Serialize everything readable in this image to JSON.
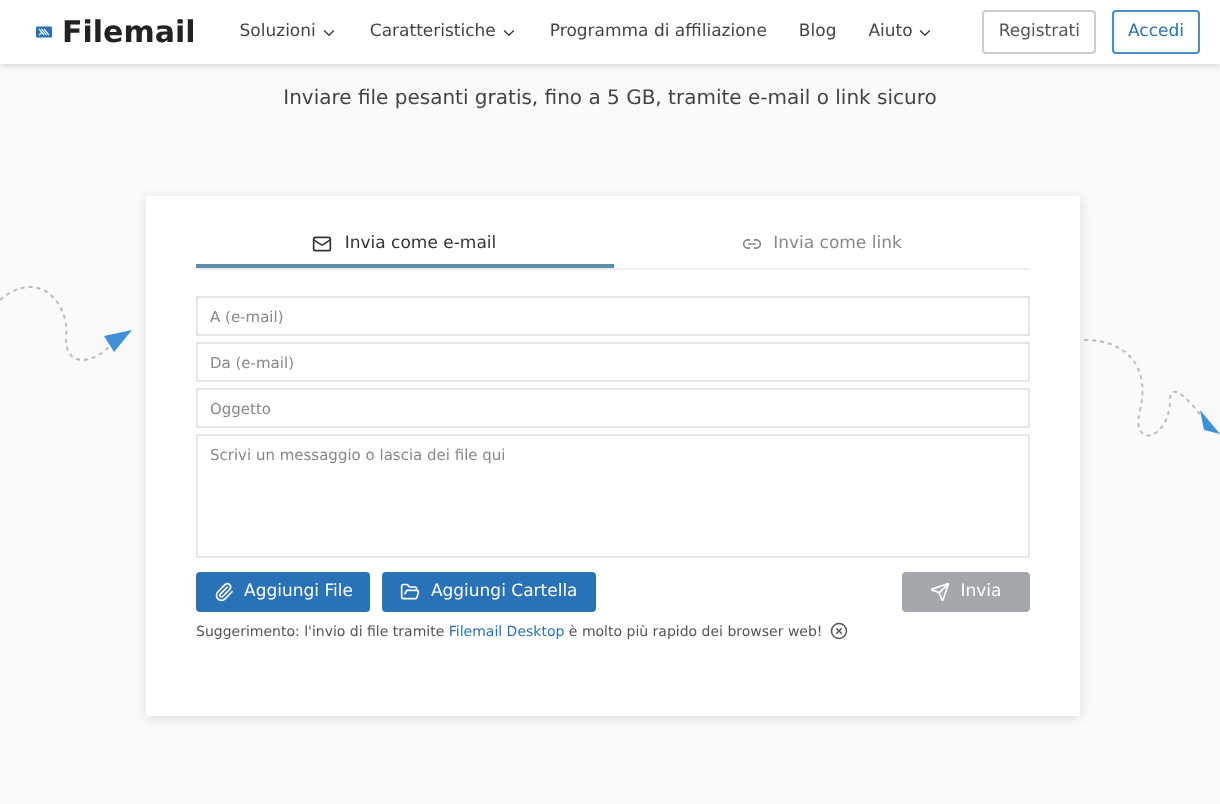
{
  "header": {
    "brand": "Filemail",
    "nav_left": [
      {
        "label": "Soluzioni"
      },
      {
        "label": "Caratteristiche"
      }
    ],
    "nav_right": [
      {
        "label": "Programma di affiliazione",
        "dropdown": false
      },
      {
        "label": "Blog",
        "dropdown": false
      },
      {
        "label": "Aiuto",
        "dropdown": true
      }
    ],
    "register": "Registrati",
    "login": "Accedi"
  },
  "subtitle": "Inviare file pesanti gratis, fino a 5 GB, tramite e-mail o link sicuro",
  "tabs": [
    {
      "label": "Invia come e-mail",
      "kind": "email",
      "selected": true
    },
    {
      "label": "Invia come link",
      "kind": "link",
      "selected": false
    }
  ],
  "fields": [
    {
      "placeholder": "A (e-mail)"
    },
    {
      "placeholder": "Da (e-mail)"
    },
    {
      "placeholder": "Oggetto"
    }
  ],
  "message": {
    "placeholder": "Scrivi un messaggio o lascia dei file qui"
  },
  "buttons": [
    {
      "label": "Aggiungi File",
      "kind": "file"
    },
    {
      "label": "Aggiungi Cartella",
      "kind": "folder"
    }
  ],
  "send": {
    "label": "Invia",
    "disabled": true
  },
  "tip": {
    "text": "Suggerimento: l'invio di file tramite",
    "link": "Filemail Desktop",
    "rest": "è molto più rapido dei browser web!"
  }
}
